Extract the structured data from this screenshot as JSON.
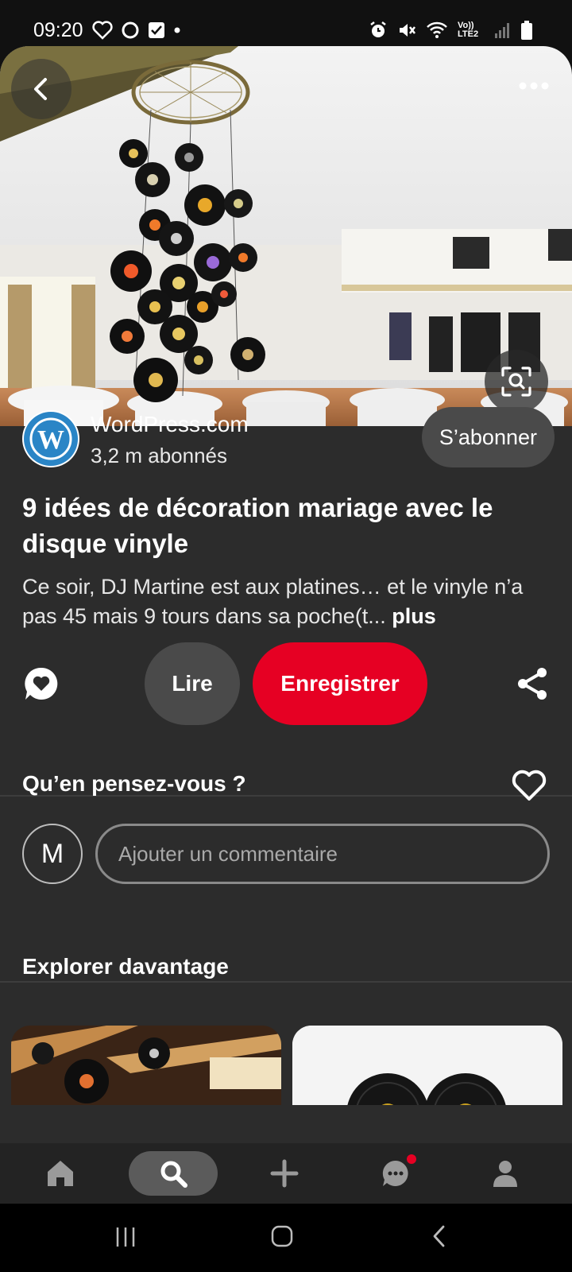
{
  "status_bar": {
    "time": "09:20",
    "network_label": "Vo)) LTE2"
  },
  "creator": {
    "name": "WordPress.com",
    "followers": "3,2 m abonnés",
    "subscribe_label": "S’abonner",
    "avatar_letter": "W"
  },
  "pin": {
    "title": "9 idées de décoration mariage avec le disque vinyle",
    "description": "Ce soir, DJ Martine est aux platines… et le vinyle n’a pas 45 mais 9 tours dans sa poche(t...",
    "more_label": "plus"
  },
  "actions": {
    "read_label": "Lire",
    "save_label": "Enregistrer"
  },
  "feedback": {
    "title": "Qu’en pensez-vous ?",
    "user_initial": "M",
    "comment_placeholder": "Ajouter un commentaire"
  },
  "explore": {
    "title": "Explorer davantage"
  },
  "colors": {
    "accent": "#e60023",
    "background": "#2c2c2c",
    "button": "#4a4a4a"
  },
  "icons": {
    "status": [
      "heart-icon",
      "circle-icon",
      "check-square-icon",
      "dot-icon",
      "alarm-icon",
      "mute-icon",
      "wifi-icon",
      "signal-icon",
      "battery-icon"
    ],
    "nav": [
      "home-icon",
      "search-icon",
      "plus-icon",
      "chat-icon",
      "profile-icon"
    ]
  }
}
